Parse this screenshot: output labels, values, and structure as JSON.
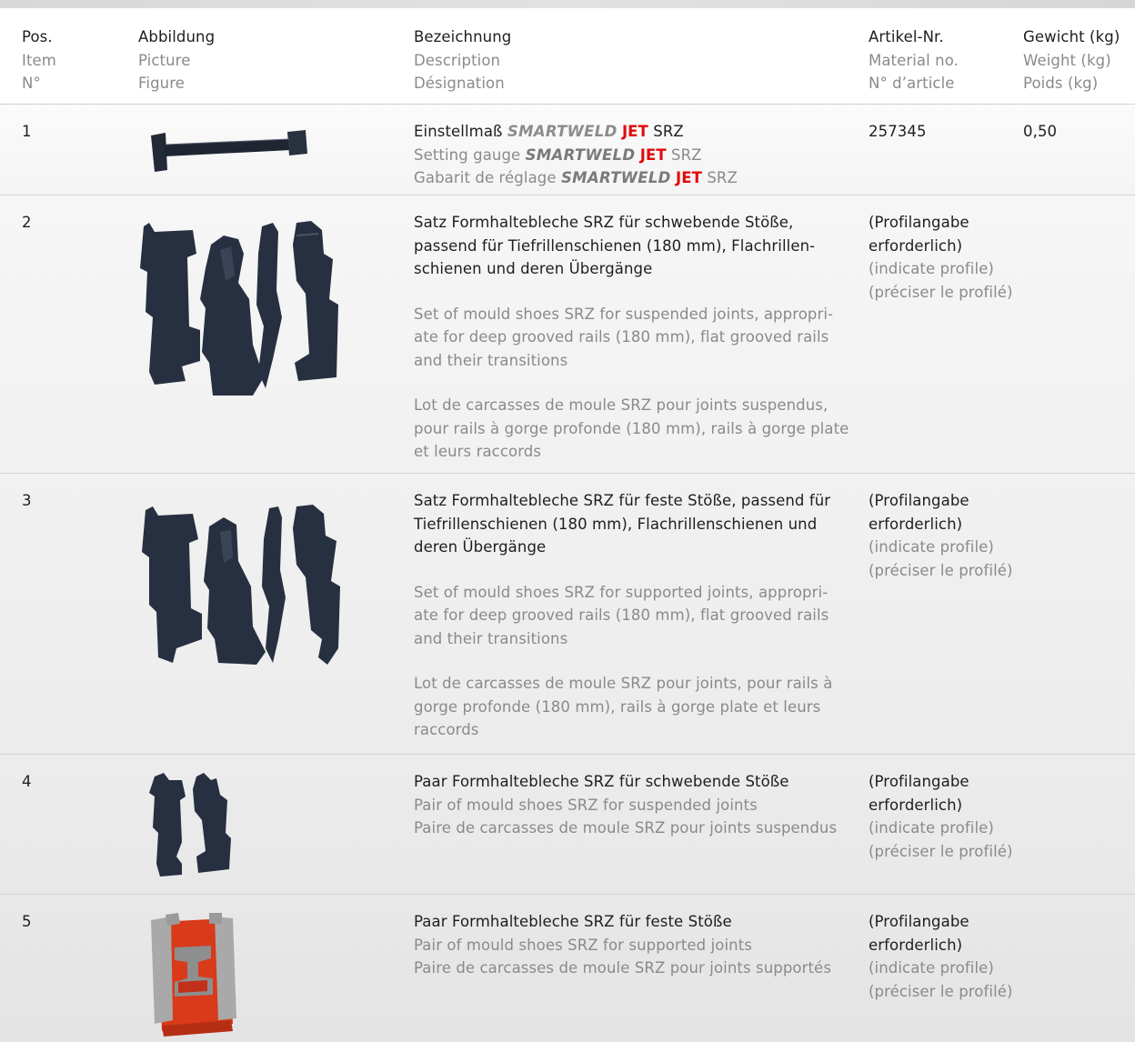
{
  "header": {
    "pos": [
      "Pos.",
      "Item",
      "N°"
    ],
    "picture": [
      "Abbildung",
      "Picture",
      "Figure"
    ],
    "description": [
      "Bezeichnung",
      "Description",
      "Désignation"
    ],
    "article": [
      "Artikel-Nr.",
      "Material no.",
      "N° d’article"
    ],
    "weight": [
      "Gewicht (kg)",
      "Weight (kg)",
      "Poids (kg)"
    ]
  },
  "brand": {
    "name": "SMARTWELD",
    "suffix": "JET",
    "suffix_color": "#e10a0a"
  },
  "rows": [
    {
      "pos": "1",
      "picture_icon": "setting-gauge-icon",
      "desc": {
        "de_prefix": "Einstellmaß",
        "de_suffix": "SRZ",
        "en_prefix": "Setting gauge",
        "en_suffix": "SRZ",
        "fr_prefix": "Gabarit de réglage",
        "fr_suffix": "SRZ"
      },
      "article": "257345",
      "weight": "0,50"
    },
    {
      "pos": "2",
      "picture_icon": "mould-shoe-set-suspended-icon",
      "desc": {
        "de": "Satz Formhaltebleche SRZ für schwebende Stöße, passend für Tiefrillenschienen (180 mm), Flachrillen-schienen und deren Übergänge",
        "en": "Set of mould shoes SRZ for suspended joints, appropri-ate for deep grooved rails (180 mm), flat grooved rails and their transitions",
        "fr": "Lot de carcasses de moule SRZ pour joints suspendus, pour rails à gorge profonde (180 mm), rails à gorge plate et leurs raccords"
      },
      "article_de": "(Profilangabe erforderlich)",
      "article_en": "(indicate profile)",
      "article_fr": "(préciser le profilé)"
    },
    {
      "pos": "3",
      "picture_icon": "mould-shoe-set-supported-icon",
      "desc": {
        "de": "Satz Formhaltebleche SRZ für feste Stöße, passend für Tiefrillenschienen (180 mm), Flachrillenschienen und deren Übergänge",
        "en": "Set of mould shoes SRZ for supported joints, appropri-ate for deep grooved rails (180 mm), flat grooved rails and their transitions",
        "fr": "Lot de carcasses de moule SRZ pour joints, pour rails à gorge profonde (180 mm), rails à gorge plate et leurs raccords"
      },
      "article_de": "(Profilangabe erforderlich)",
      "article_en": "(indicate profile)",
      "article_fr": "(préciser le profilé)"
    },
    {
      "pos": "4",
      "picture_icon": "mould-shoe-pair-suspended-icon",
      "desc": {
        "de": "Paar Formhaltebleche SRZ für schwebende Stöße",
        "en": "Pair of mould shoes SRZ for suspended joints",
        "fr": "Paire de carcasses de moule SRZ pour joints suspendus"
      },
      "article_de": "(Profilangabe erforderlich)",
      "article_en": "(indicate profile)",
      "article_fr": "(préciser le profilé)"
    },
    {
      "pos": "5",
      "picture_icon": "mould-shoe-pair-supported-icon",
      "desc": {
        "de": "Paar Formhaltebleche SRZ für feste Stöße",
        "en": "Pair of mould shoes SRZ for supported joints",
        "fr": "Paire de carcasses de moule SRZ pour joints supportés"
      },
      "article_de": "(Profilangabe erforderlich)",
      "article_en": "(indicate profile)",
      "article_fr": "(préciser le profilé)"
    }
  ],
  "colors": {
    "text": "#1e1e1e",
    "secondary_text": "#8a8a8a",
    "part_dark": "#263040",
    "part_red": "#d93a1a",
    "part_gray": "#a9a9a9"
  }
}
